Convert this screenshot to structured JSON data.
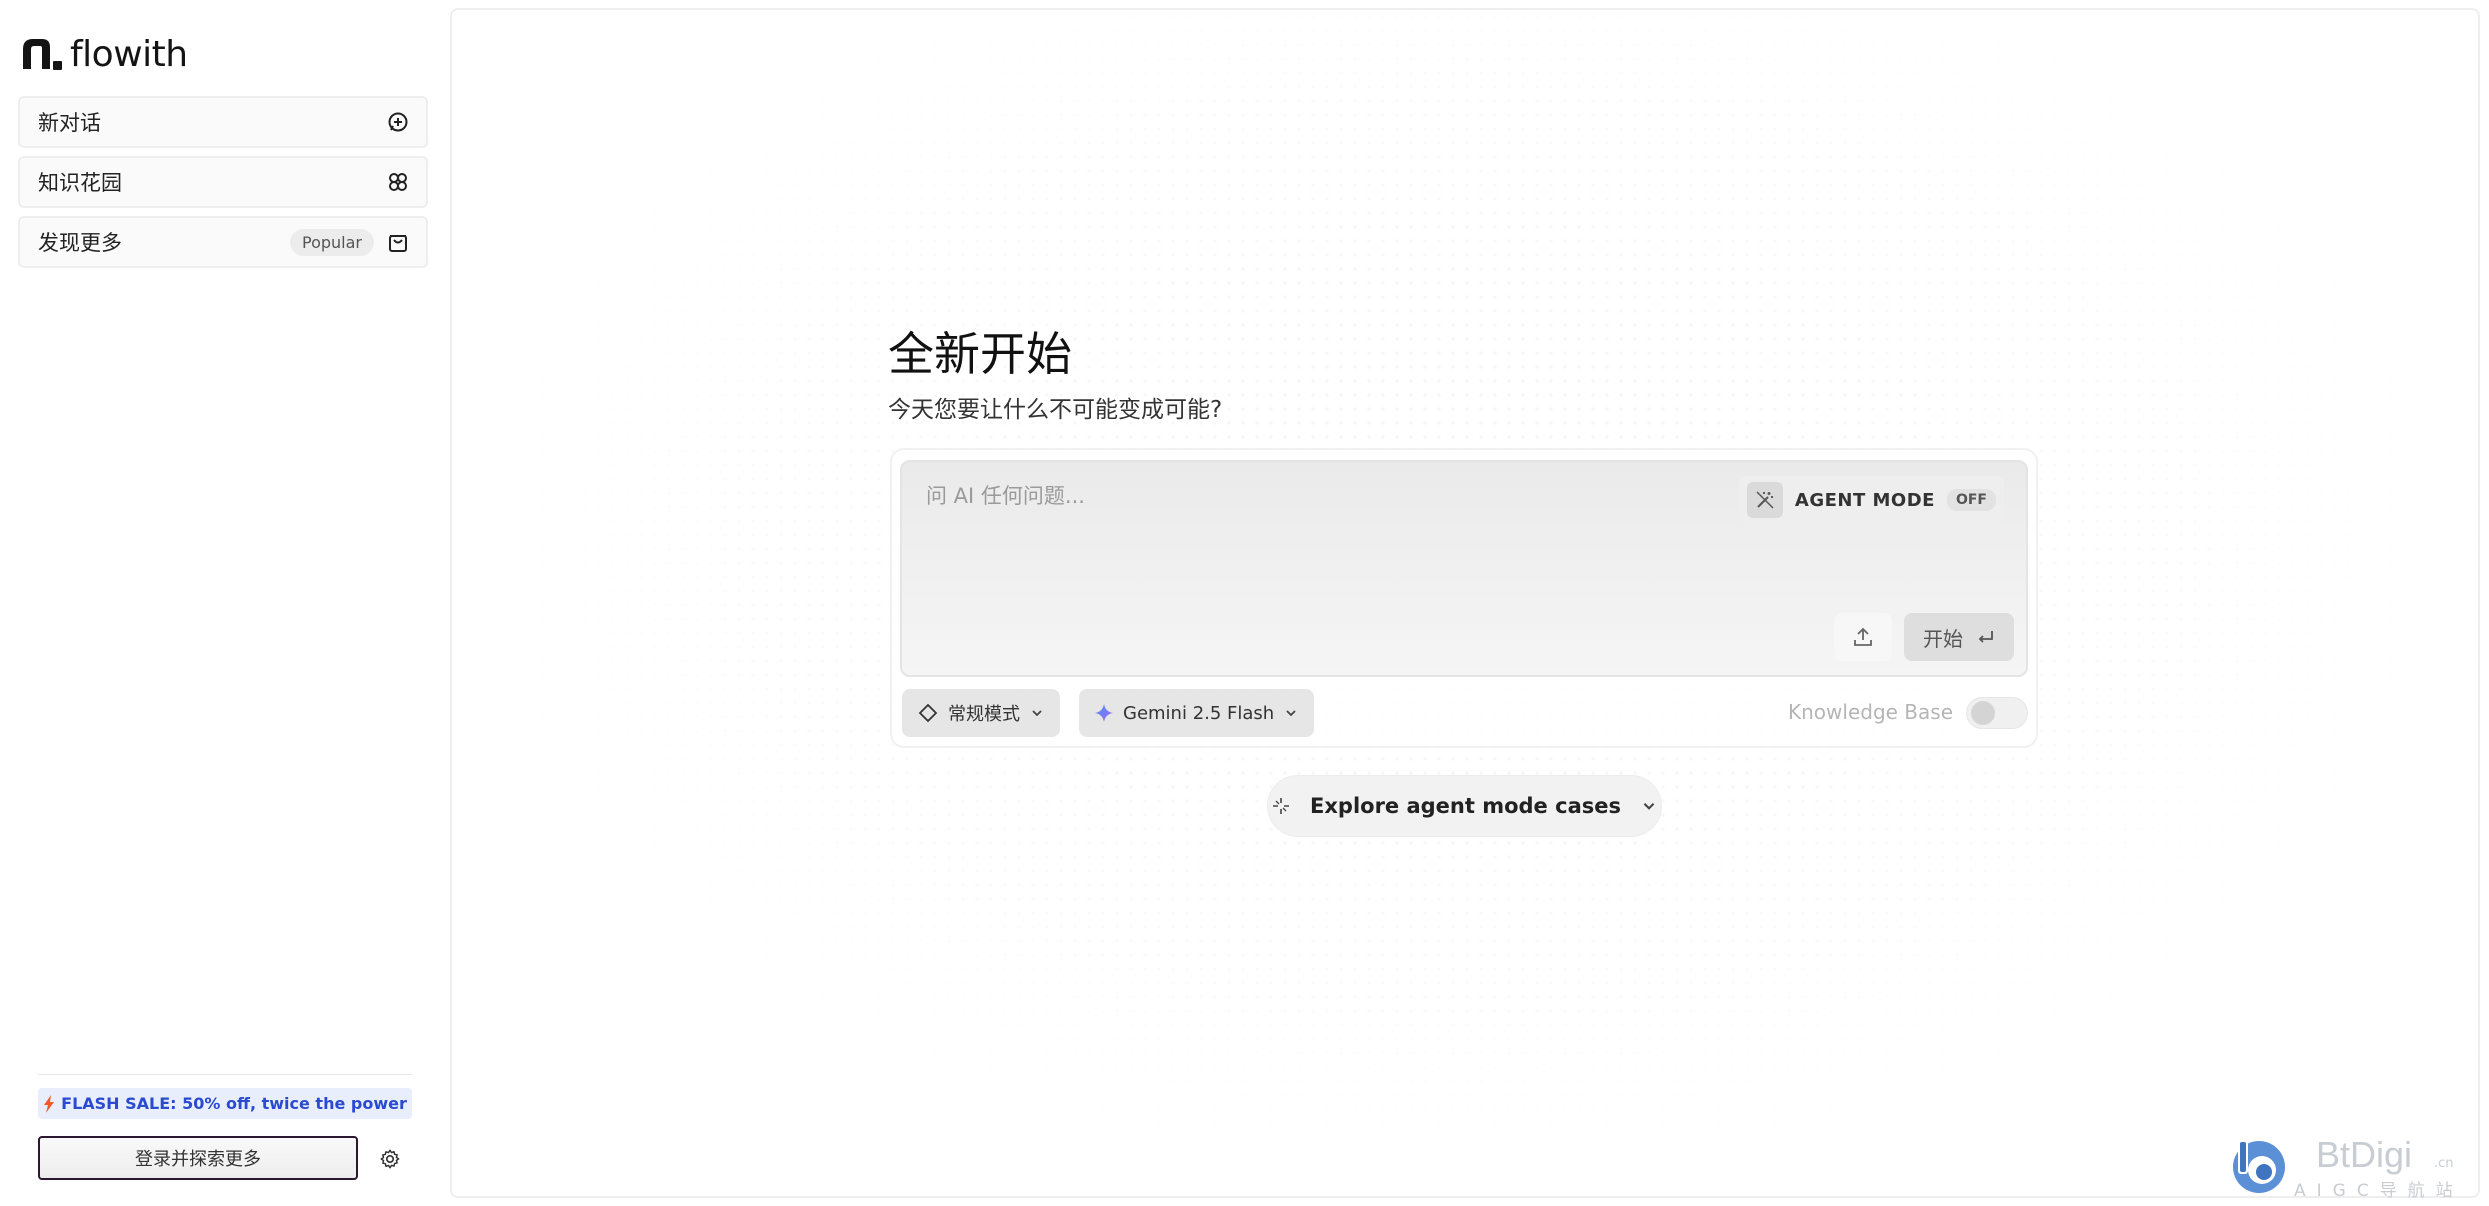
{
  "app": {
    "logo_text": "flowith"
  },
  "sidebar": {
    "items": [
      {
        "label": "新对话",
        "icon": "chat-plus-icon"
      },
      {
        "label": "知识花园",
        "icon": "clover-icon"
      },
      {
        "label": "发现更多",
        "badge": "Popular",
        "icon": "shopping-bag-icon"
      }
    ],
    "flash_sale": "FLASH SALE: 50% off, twice the power",
    "login_label": "登录并探索更多"
  },
  "main": {
    "title": "全新开始",
    "subtitle": "今天您要让什么不可能变成可能?",
    "composer": {
      "placeholder": "问 AI 任何问题...",
      "agent_mode_label": "AGENT MODE",
      "agent_mode_state": "OFF",
      "start_label": "开始"
    },
    "mode_select": "常规模式",
    "model_select": "Gemini 2.5 Flash",
    "knowledge_base_label": "Knowledge Base",
    "knowledge_base_enabled": false,
    "explore_label": "Explore agent mode cases"
  },
  "watermark": {
    "title": "BtDigi",
    "suffix": ".cn",
    "subtitle": "AIGC导航站"
  },
  "colors": {
    "flash_sale_text": "#2a4ad1",
    "flash_sale_bg": "#e9eefc",
    "bolt": "#f05a28"
  }
}
